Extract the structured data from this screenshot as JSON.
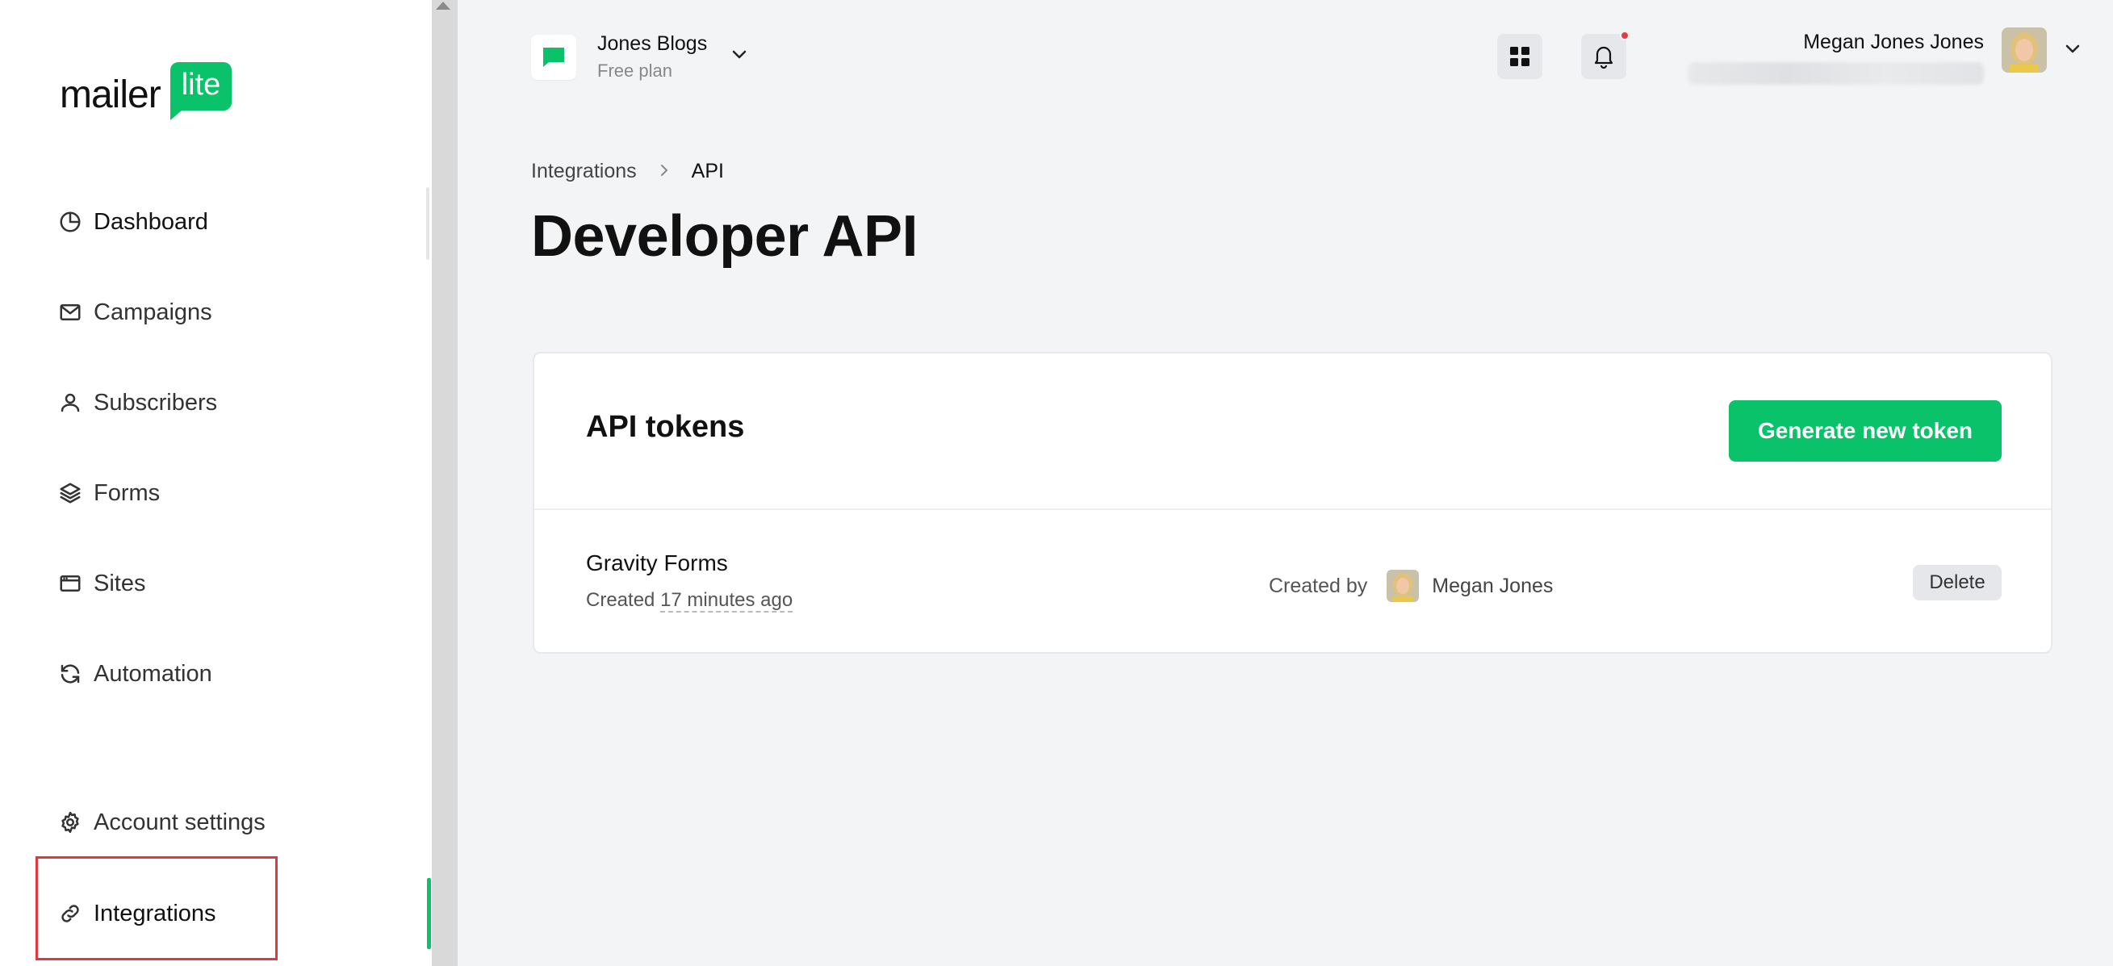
{
  "brand": {
    "name": "mailer",
    "badge": "lite",
    "color": "#09c269"
  },
  "sidebar": {
    "items": [
      {
        "label": "Dashboard",
        "icon": "pie-chart-icon"
      },
      {
        "label": "Campaigns",
        "icon": "envelope-icon"
      },
      {
        "label": "Subscribers",
        "icon": "user-icon"
      },
      {
        "label": "Forms",
        "icon": "layers-icon"
      },
      {
        "label": "Sites",
        "icon": "browser-window-icon"
      },
      {
        "label": "Automation",
        "icon": "refresh-icon"
      },
      {
        "label": "Account settings",
        "icon": "gear-icon"
      },
      {
        "label": "Integrations",
        "icon": "link-icon",
        "active": true
      }
    ]
  },
  "header": {
    "workspace": {
      "name": "Jones Blogs",
      "plan": "Free plan"
    },
    "user": {
      "name": "Megan Jones Jones"
    }
  },
  "breadcrumb": {
    "parent": "Integrations",
    "current": "API"
  },
  "page": {
    "title": "Developer API"
  },
  "tokens": {
    "title": "API tokens",
    "generate_label": "Generate new token",
    "rows": [
      {
        "name": "Gravity Forms",
        "created_prefix": "Created",
        "created_when": "17 minutes ago",
        "created_by_label": "Created by",
        "created_by": "Megan Jones",
        "delete_label": "Delete"
      }
    ]
  }
}
